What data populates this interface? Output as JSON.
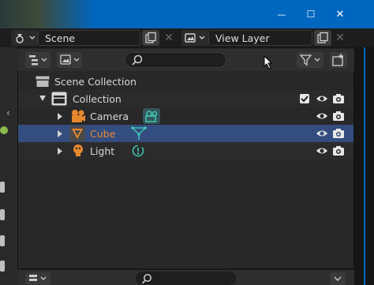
{
  "window": {
    "minimize_glyph": "—",
    "maximize_glyph": "☐",
    "close_glyph": "✕"
  },
  "header": {
    "scene_label": "Scene",
    "view_layer_label": "View Layer"
  },
  "outliner": {
    "search_placeholder": "",
    "items": [
      {
        "label": "Scene Collection",
        "type": "scene-collection"
      },
      {
        "label": "Collection",
        "type": "collection"
      },
      {
        "label": "Camera",
        "type": "camera"
      },
      {
        "label": "Cube",
        "type": "mesh",
        "selected": true
      },
      {
        "label": "Light",
        "type": "light"
      }
    ]
  },
  "colors": {
    "accent_blue": "#0067c0",
    "selection": "#334d80",
    "object_orange": "#e8882e",
    "data_teal": "#3fc4b0"
  }
}
